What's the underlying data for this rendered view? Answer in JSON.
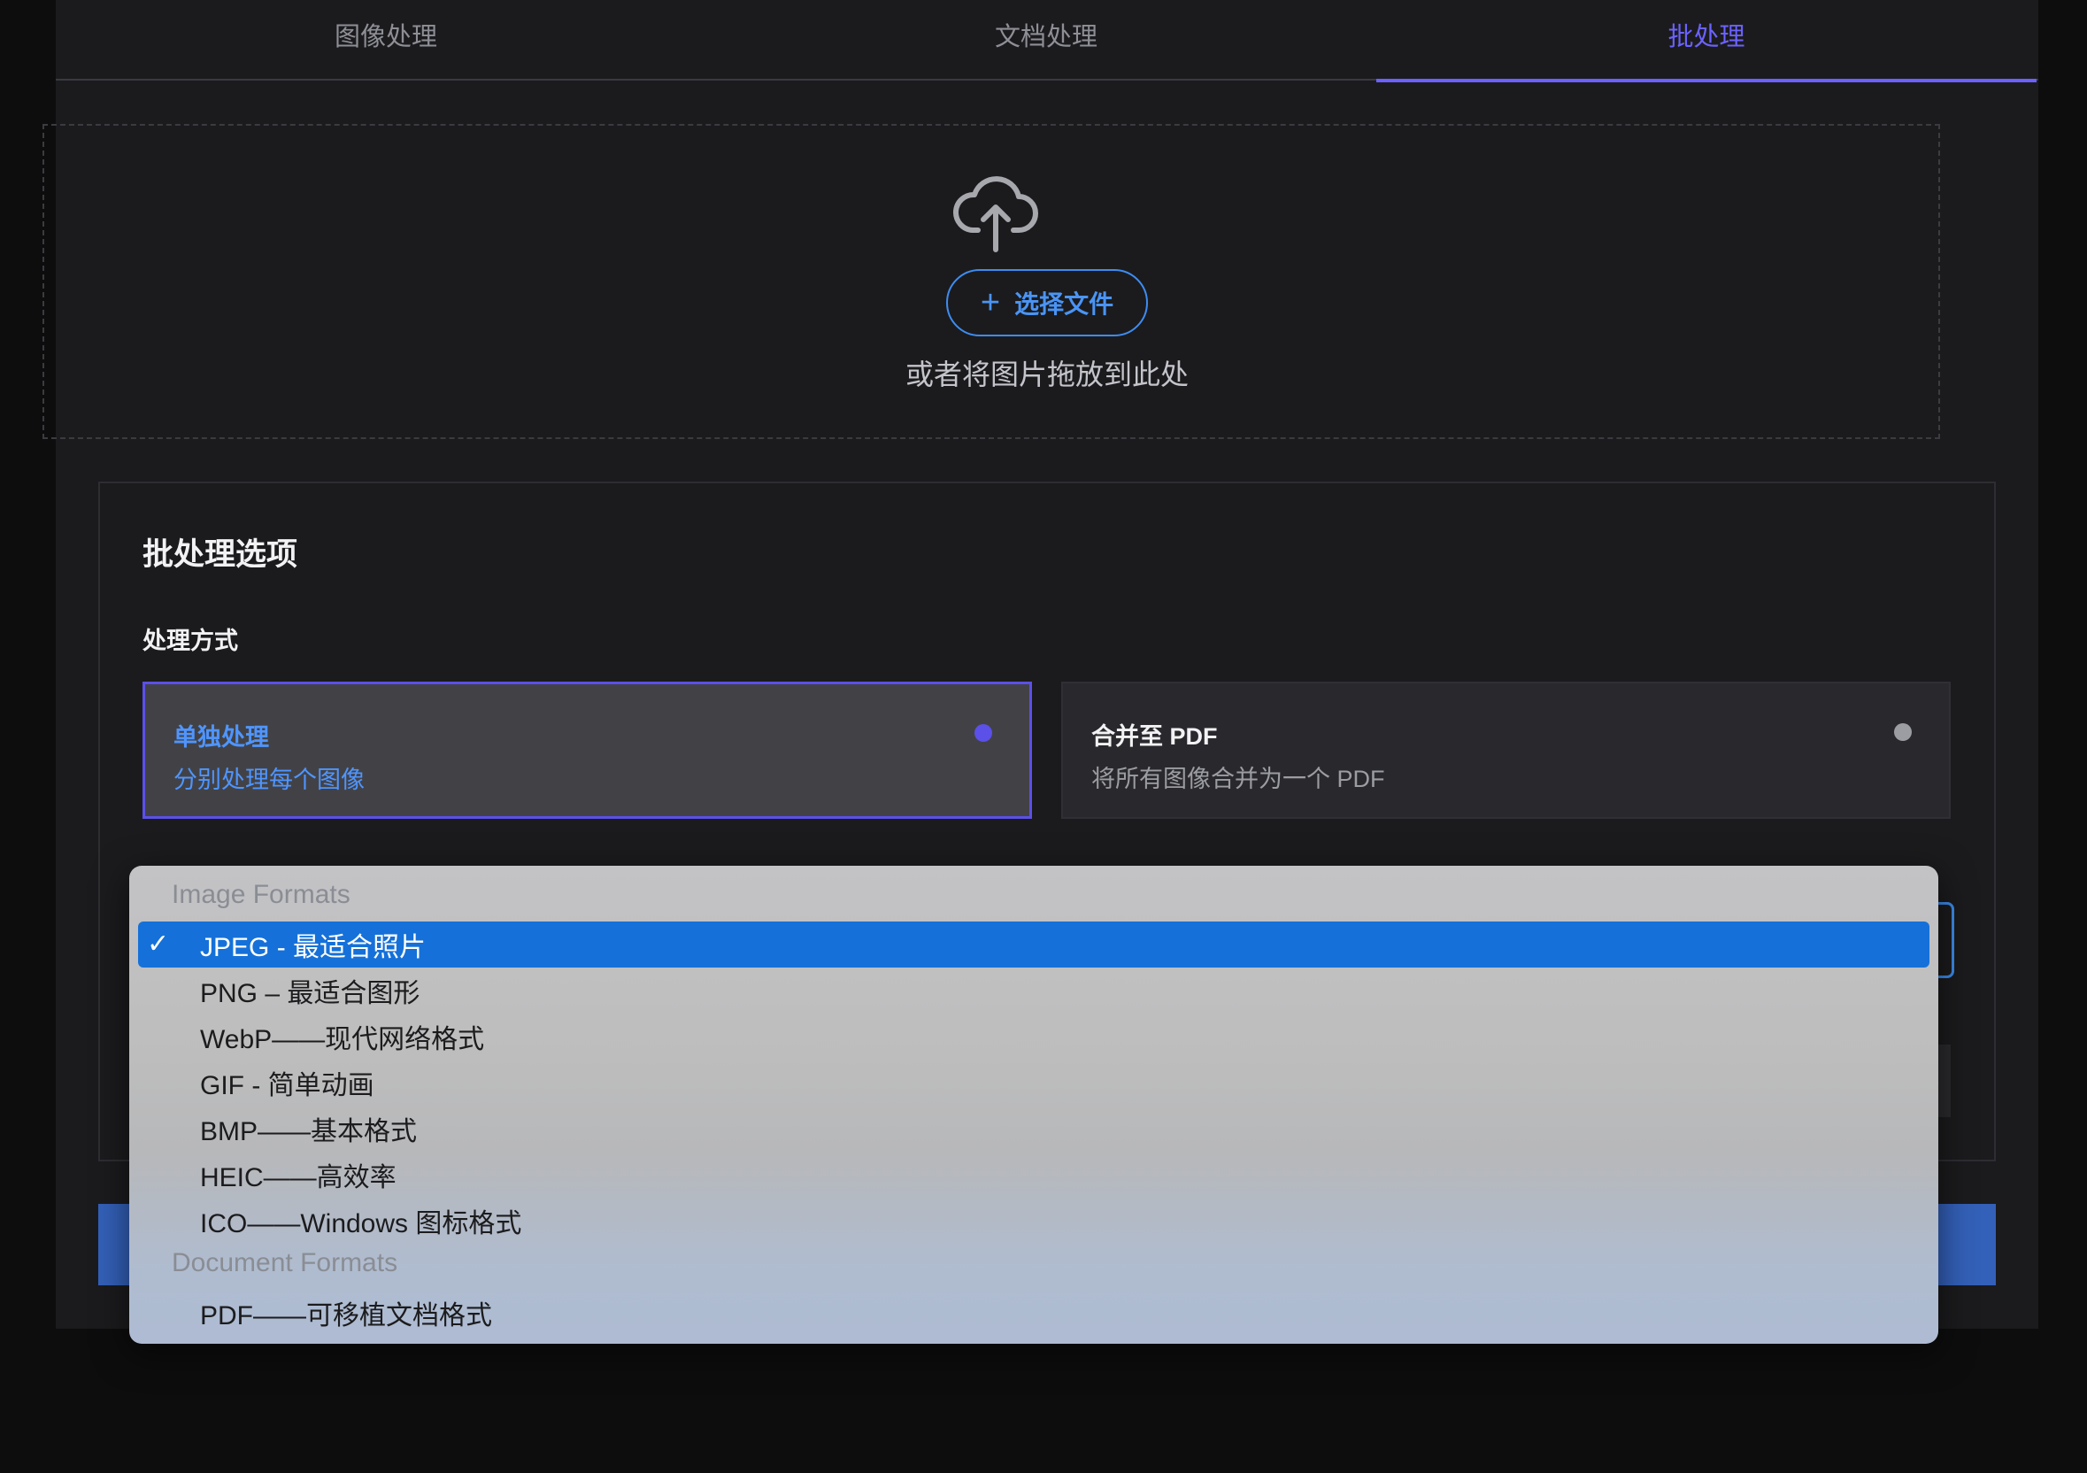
{
  "tabs": [
    {
      "label": "图像处理",
      "active": false
    },
    {
      "label": "文档处理",
      "active": false
    },
    {
      "label": "批处理",
      "active": true
    }
  ],
  "upload": {
    "icon": "cloud-upload-icon",
    "button_label": "选择文件",
    "button_icon": "plus-icon",
    "hint": "或者将图片拖放到此处"
  },
  "batch_options": {
    "title": "批处理选项",
    "method_label": "处理方式",
    "methods": [
      {
        "name": "单独处理",
        "desc": "分别处理每个图像",
        "selected": true
      },
      {
        "name": "合并至 PDF",
        "desc": "将所有图像合并为一个 PDF",
        "selected": false
      }
    ]
  },
  "format_dropdown": {
    "groups": [
      {
        "label": "Image Formats",
        "options": [
          {
            "label": "JPEG - 最适合照片",
            "selected": true
          },
          {
            "label": "PNG – 最适合图形",
            "selected": false
          },
          {
            "label": "WebP——现代网络格式",
            "selected": false
          },
          {
            "label": "GIF - 简单动画",
            "selected": false
          },
          {
            "label": "BMP——基本格式",
            "selected": false
          },
          {
            "label": "HEIC——高效率",
            "selected": false
          },
          {
            "label": "ICO——Windows 图标格式",
            "selected": false
          }
        ]
      },
      {
        "label": "Document Formats",
        "options": [
          {
            "label": "PDF——可移植文档格式",
            "selected": false
          }
        ]
      }
    ],
    "check_glyph": "✓"
  },
  "colors": {
    "accent_tab": "#6b62ff",
    "accent_blue": "#3e8cf2",
    "selected_option": "#1571d9",
    "primary_button": "#3360b8"
  }
}
